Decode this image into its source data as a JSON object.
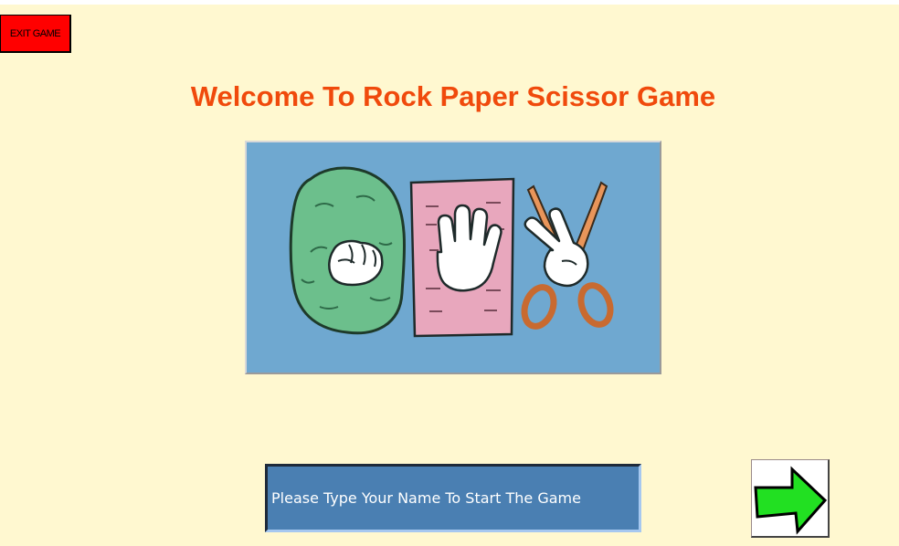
{
  "exit_button": {
    "label": "EXIT GAME"
  },
  "title": "Welcome To Rock Paper Scissor Game",
  "name_prompt": {
    "text": "Please Type Your Name To Start The Game"
  },
  "illustration": {
    "icons": [
      "rock-hand-icon",
      "paper-hand-icon",
      "scissors-hand-icon"
    ]
  },
  "next_button": {
    "icon": "green-arrow-right-icon"
  },
  "colors": {
    "background": "#fff8d0",
    "title": "#f04a0c",
    "exit_button": "#ff0000",
    "name_box": "#4a7fb2",
    "arrow": "#22e022",
    "illustration_bg": "#6fa8d0"
  }
}
